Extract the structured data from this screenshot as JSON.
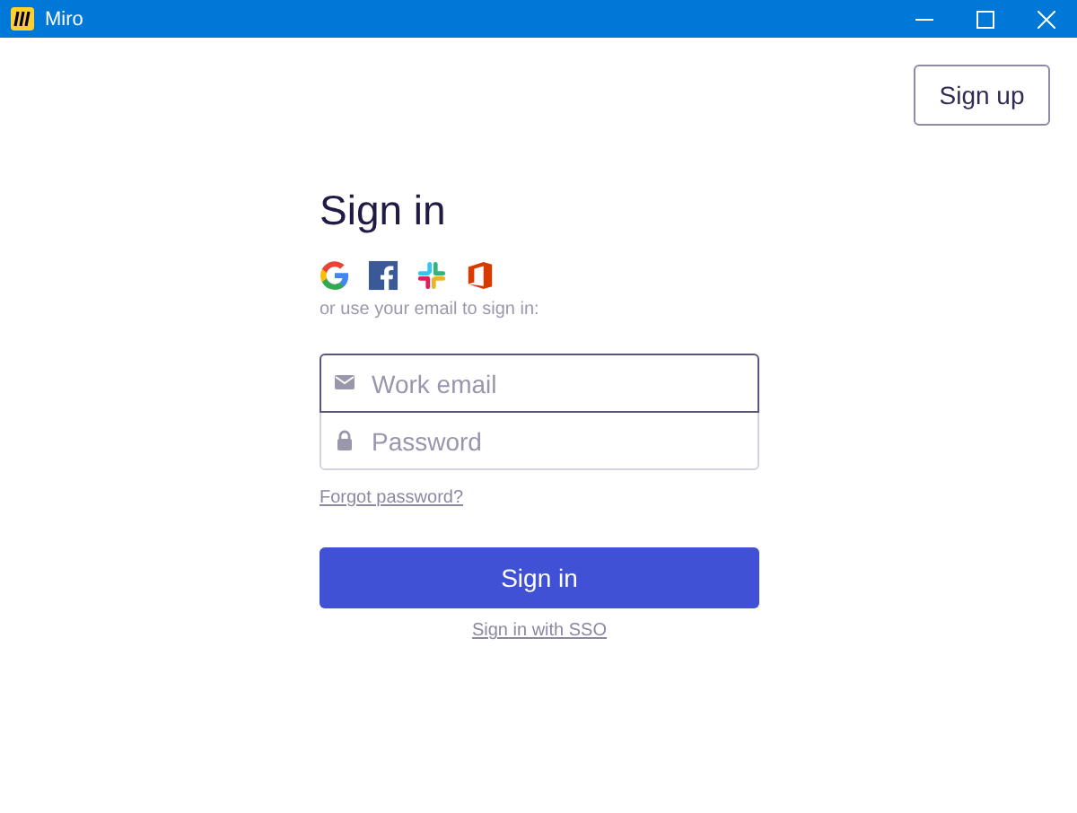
{
  "window": {
    "title": "Miro"
  },
  "header": {
    "signup_button": "Sign up"
  },
  "form": {
    "title": "Sign in",
    "providers": [
      {
        "kind": "google"
      },
      {
        "kind": "facebook"
      },
      {
        "kind": "slack"
      },
      {
        "kind": "office"
      }
    ],
    "caption": "or use your email to sign in:",
    "fields": [
      {
        "kind": "email",
        "placeholder": "Work email",
        "focused": true
      },
      {
        "kind": "password",
        "placeholder": "Password",
        "focused": false
      }
    ],
    "forgot_link": "Forgot password?",
    "submit_button": "Sign in",
    "sso_link": "Sign in with SSO"
  }
}
